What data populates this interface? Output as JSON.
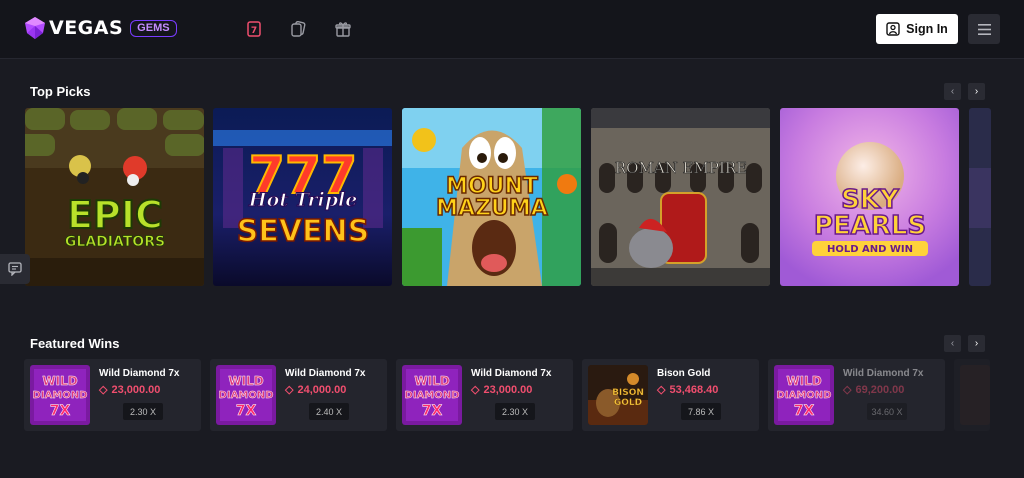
{
  "header": {
    "logo_main": "VEGAS",
    "logo_badge": "GEMS",
    "nav_icons": [
      "slots-seven-icon",
      "cards-icon",
      "gift-icon"
    ],
    "signin_label": "Sign In",
    "menu_icon": "hamburger-menu-icon"
  },
  "colors": {
    "background": "#1a1b22",
    "topbar": "#14151b",
    "accent_red": "#f04e6e",
    "accent_purple": "#7a3cff"
  },
  "top_picks": {
    "title": "Top Picks",
    "games": [
      {
        "name": "EPIC GLADIATORS",
        "line1": "EPIC",
        "line2": "GLADIATORS"
      },
      {
        "name": "Hot Triple SEVENS",
        "line1": "Hot Triple",
        "line2": "SEVENS"
      },
      {
        "name": "MOUNT MAZUMA",
        "line1": "MOUNT",
        "line2": "MAZUMA"
      },
      {
        "name": "ROMAN EMPIRE",
        "line1": "ROMAN EMPIRE",
        "line2": ""
      },
      {
        "name": "SKY PEARLS HOLD AND WIN",
        "line1": "SKY",
        "line2": "PEARLS",
        "line3": "HOLD AND WIN"
      }
    ]
  },
  "featured_wins": {
    "title": "Featured Wins",
    "items": [
      {
        "game": "Wild Diamond 7x",
        "amount": "23,000.00",
        "multiplier": "2.30 X",
        "thumb_line1": "WILD",
        "thumb_line2": "DIAMOND",
        "thumb_line3": "7X"
      },
      {
        "game": "Wild Diamond 7x",
        "amount": "24,000.00",
        "multiplier": "2.40 X",
        "thumb_line1": "WILD",
        "thumb_line2": "DIAMOND",
        "thumb_line3": "7X"
      },
      {
        "game": "Wild Diamond 7x",
        "amount": "23,000.00",
        "multiplier": "2.30 X",
        "thumb_line1": "WILD",
        "thumb_line2": "DIAMOND",
        "thumb_line3": "7X"
      },
      {
        "game": "Bison Gold",
        "amount": "53,468.40",
        "multiplier": "7.86 X",
        "thumb_line1": "BISON",
        "thumb_line2": "GOLD",
        "thumb_line3": ""
      },
      {
        "game": "Wild Diamond 7x",
        "amount": "69,200.00",
        "multiplier": "34.60 X",
        "thumb_line1": "WILD",
        "thumb_line2": "DIAMOND",
        "thumb_line3": "7X"
      }
    ]
  },
  "chat_icon": "chat-icon"
}
